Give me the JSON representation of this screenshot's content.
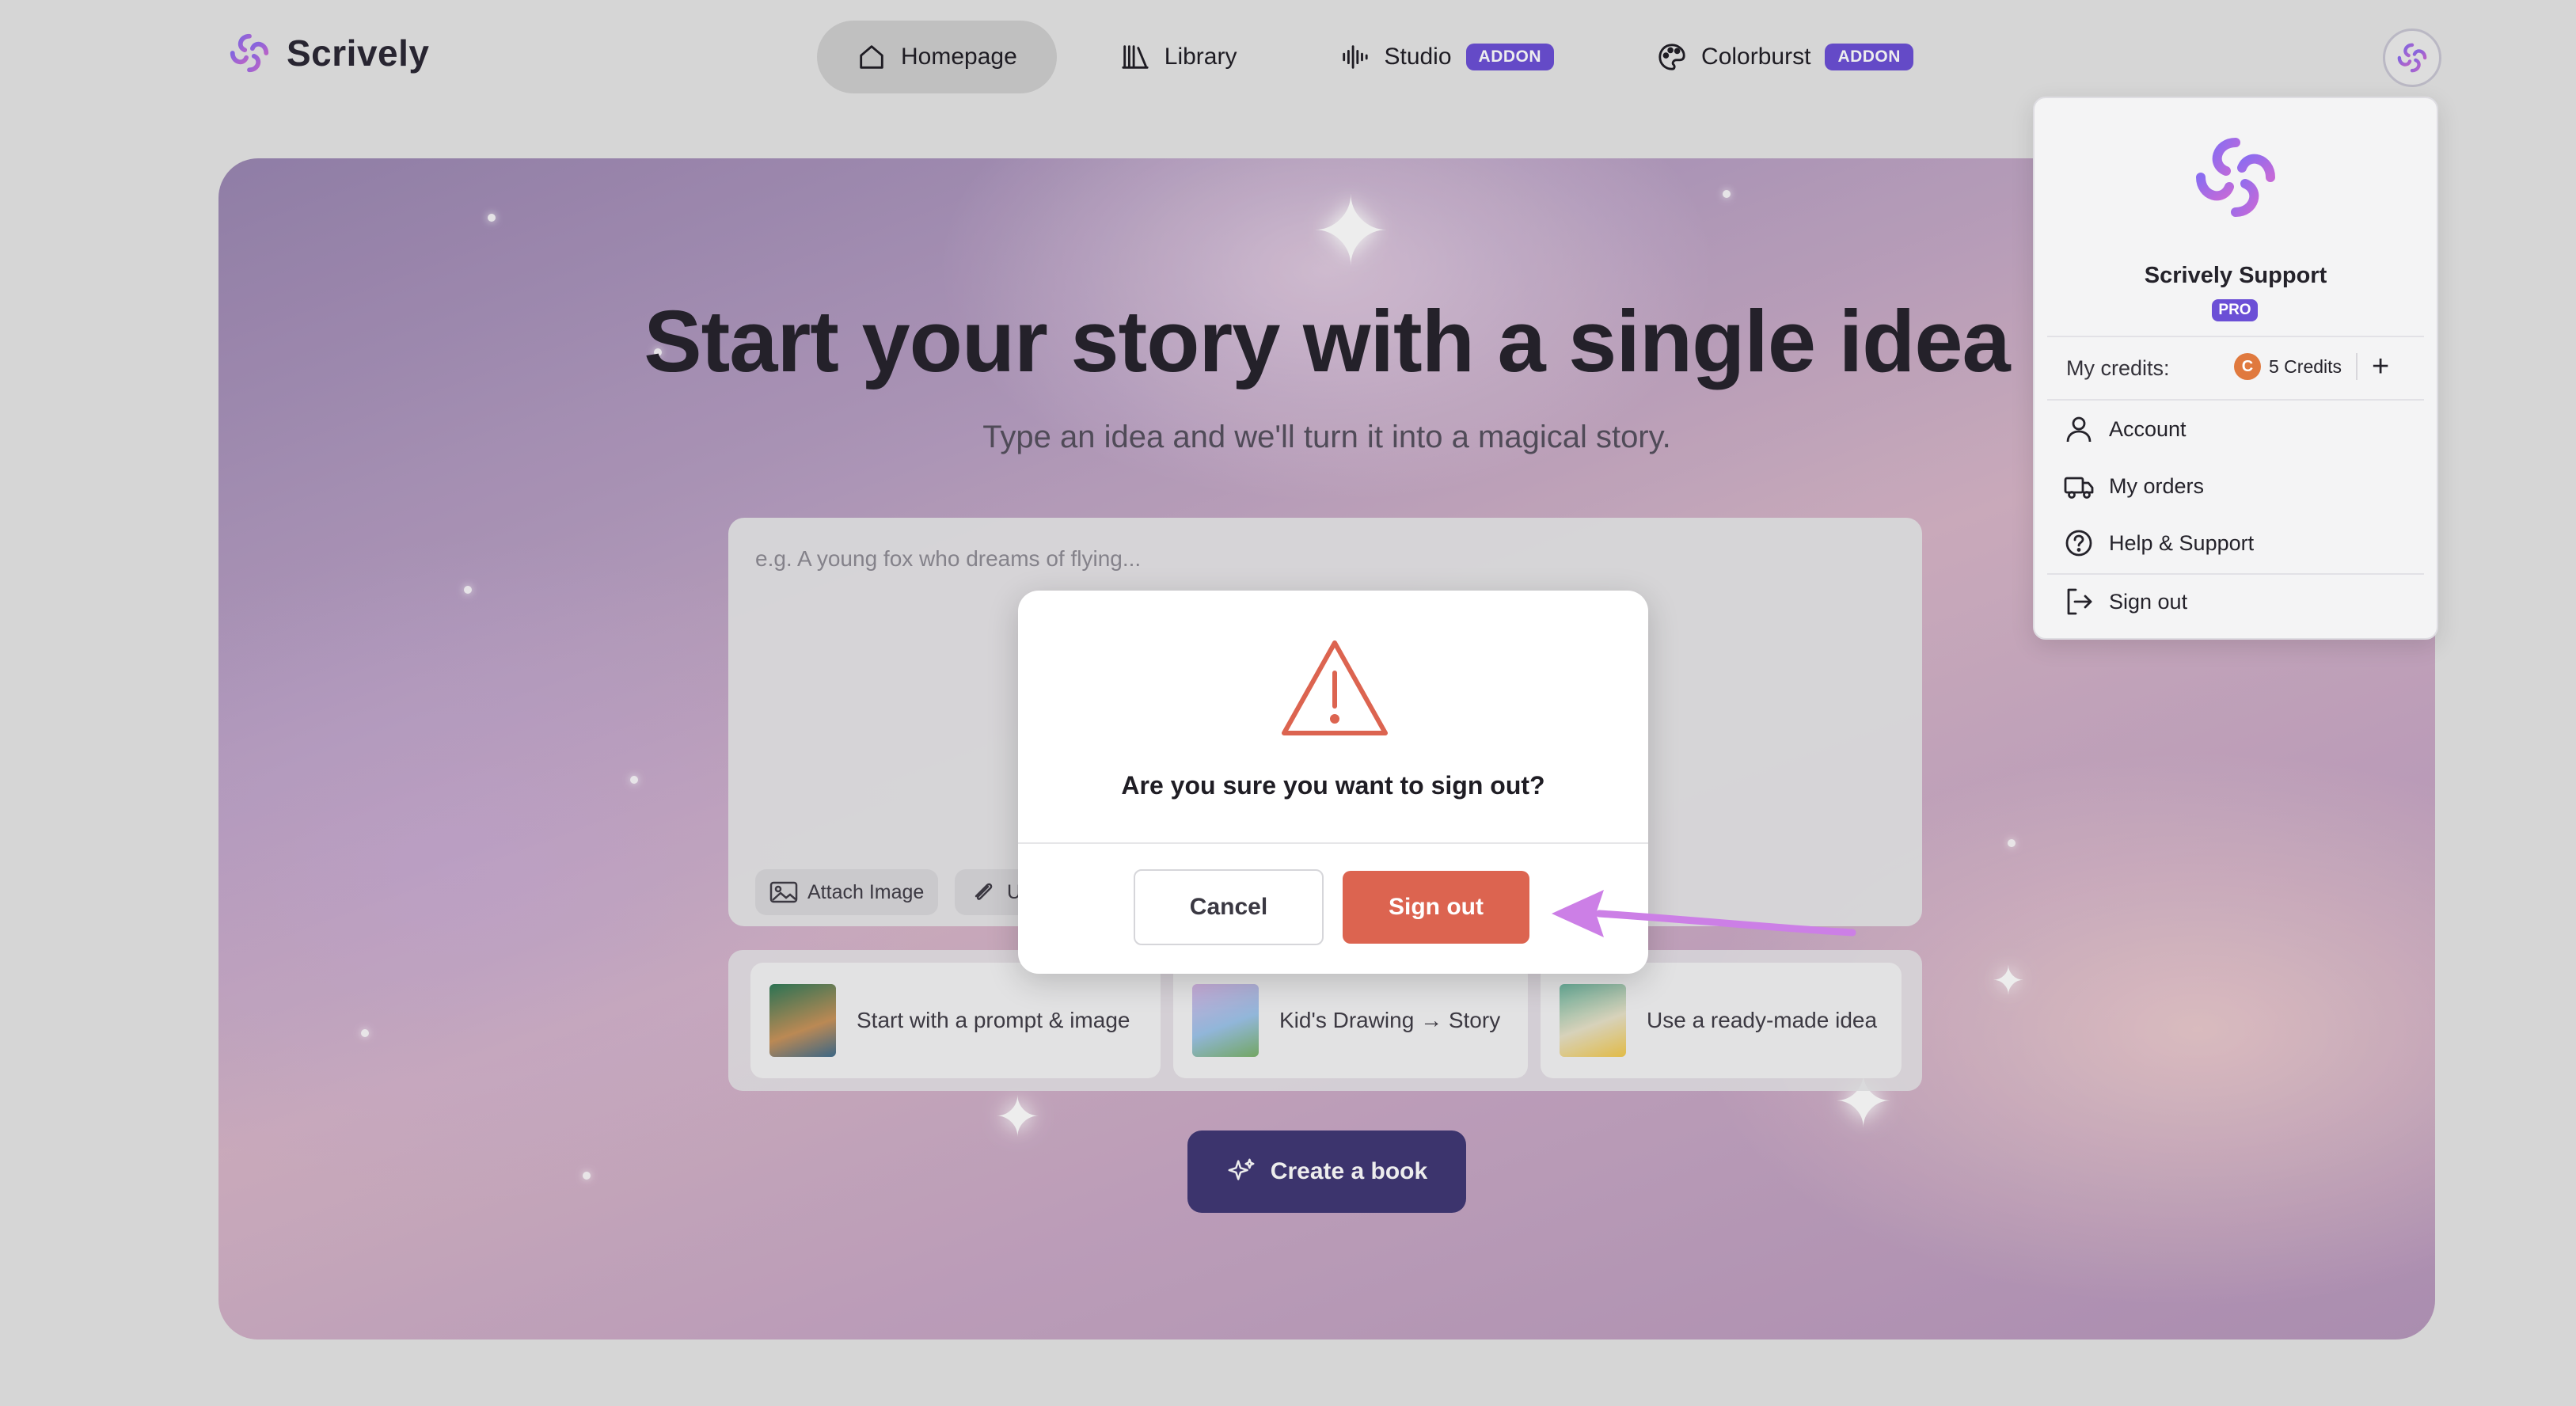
{
  "brand": {
    "name": "Scrively"
  },
  "nav": {
    "items": [
      {
        "label": "Homepage"
      },
      {
        "label": "Library"
      },
      {
        "label": "Studio",
        "badge": "ADDON"
      },
      {
        "label": "Colorburst",
        "badge": "ADDON"
      }
    ]
  },
  "hero": {
    "title": "Start your story with a single idea",
    "subtitle": "Type an idea and we'll turn it into a magical story.",
    "prompt_placeholder": "e.g. A young fox who dreams of flying...",
    "chips": {
      "attach_image": "Attach Image",
      "upload_partial": "U"
    },
    "tiles": [
      {
        "label": "Start with a prompt & image"
      },
      {
        "label": "Kid's Drawing → Story"
      },
      {
        "label": "Use a ready-made idea"
      }
    ],
    "create_button": "Create a book"
  },
  "dialog": {
    "message": "Are you sure you want to sign out?",
    "cancel": "Cancel",
    "confirm": "Sign out"
  },
  "user_menu": {
    "name": "Scrively Support",
    "plan": "PRO",
    "credits_label": "My credits:",
    "credits_value": "5 Credits",
    "coin_glyph": "C",
    "items": [
      {
        "label": "Account",
        "icon": "user-icon"
      },
      {
        "label": "My orders",
        "icon": "truck-icon"
      },
      {
        "label": "Help & Support",
        "icon": "help-circle-icon"
      },
      {
        "label": "Sign out",
        "icon": "logout-icon"
      }
    ]
  },
  "colors": {
    "accent": "#6b4fd6",
    "danger": "#dc6450",
    "create_button": "#3f3775",
    "annotation_arrow": "#cc7fe6"
  }
}
